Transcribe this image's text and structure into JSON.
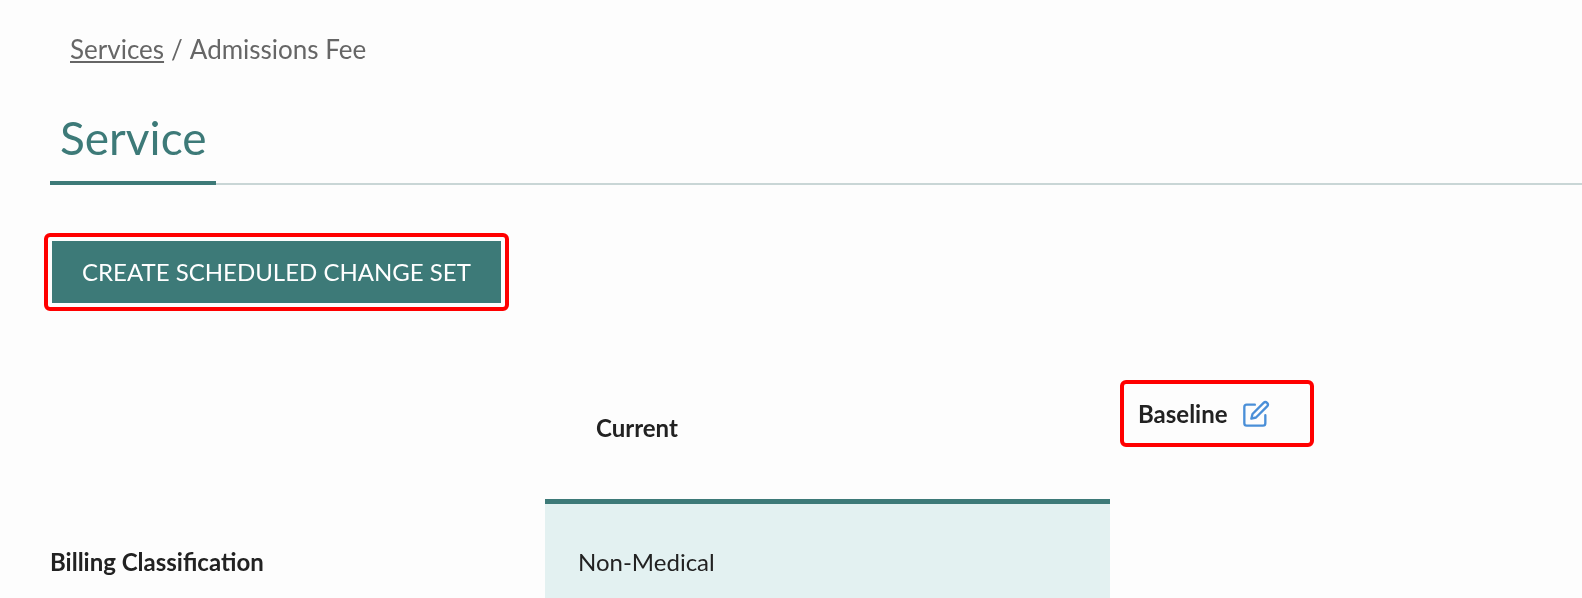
{
  "breadcrumb": {
    "link": "Services",
    "separator": "/",
    "current": "Admissions Fee"
  },
  "heading": "Service",
  "action_button": {
    "label": "CREATE SCHEDULED CHANGE SET",
    "highlighted": true
  },
  "table": {
    "columns": [
      {
        "label": "Current",
        "editable": false,
        "highlighted": false
      },
      {
        "label": "Baseline",
        "editable": true,
        "highlighted": true
      }
    ],
    "rows": [
      {
        "label": "Billing Classification",
        "current": "Non-Medical"
      }
    ]
  }
}
